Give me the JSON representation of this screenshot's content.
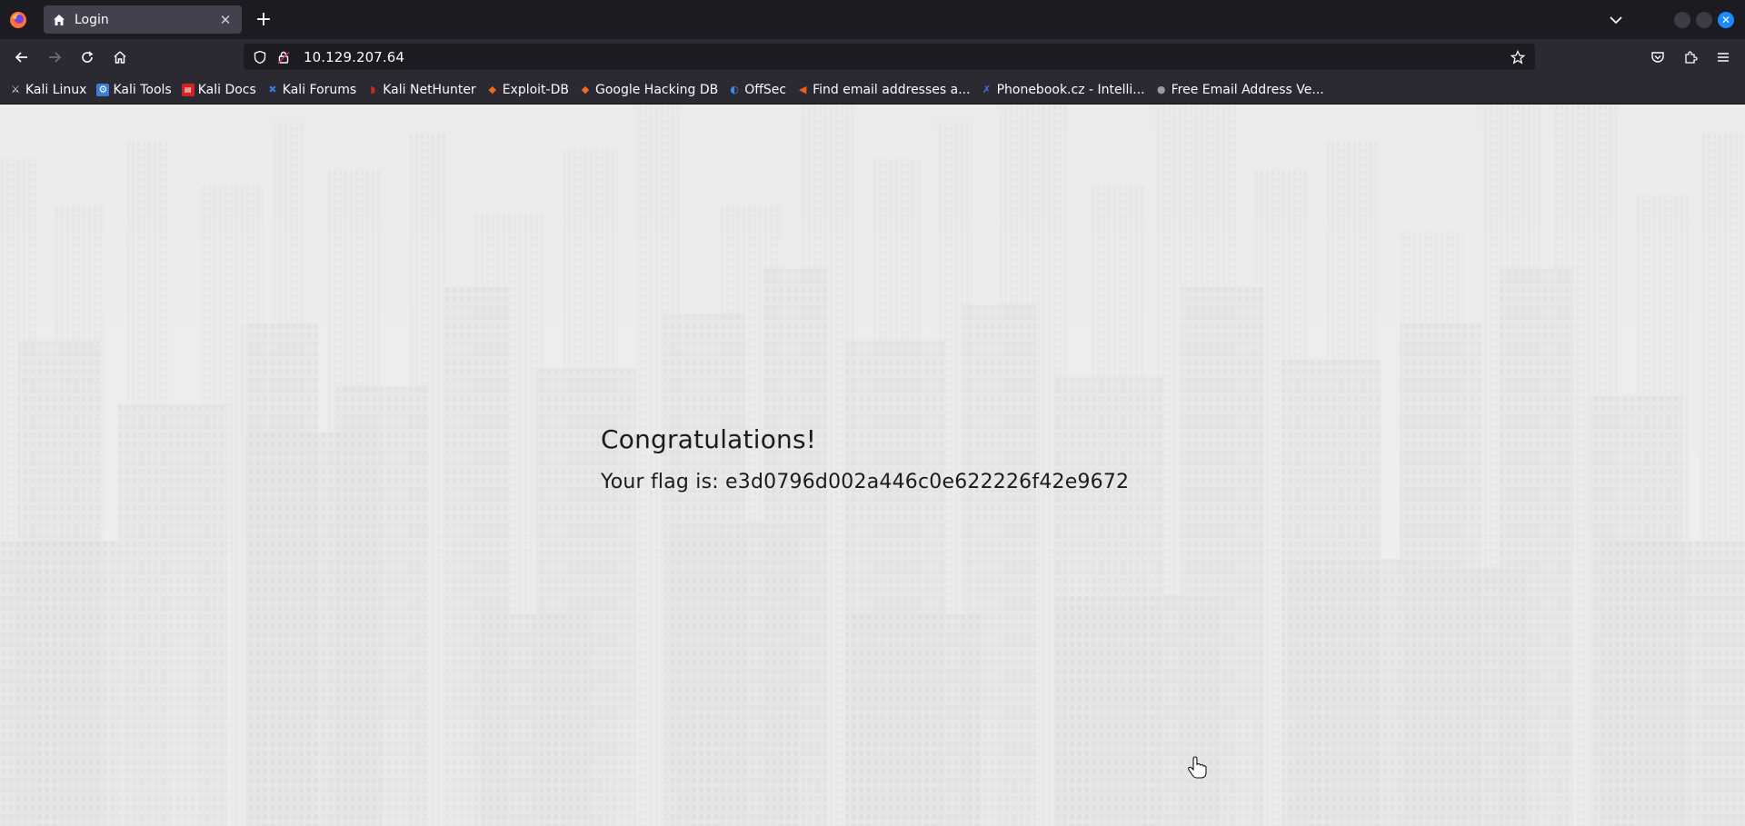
{
  "browser": {
    "tab": {
      "title": "Login"
    },
    "url": "10.129.207.64",
    "bookmarks": [
      {
        "label": "Kali Linux",
        "icon": "kali-dragon-icon",
        "color": "#e6e6e6"
      },
      {
        "label": "Kali Tools",
        "icon": "kali-tools-icon",
        "color": "#3e7bd8"
      },
      {
        "label": "Kali Docs",
        "icon": "kali-docs-icon",
        "color": "#d12424"
      },
      {
        "label": "Kali Forums",
        "icon": "kali-forums-icon",
        "color": "#3a78d8"
      },
      {
        "label": "Kali NetHunter",
        "icon": "nethunter-icon",
        "color": "#d12424"
      },
      {
        "label": "Exploit-DB",
        "icon": "exploit-db-icon",
        "color": "#f06a1f"
      },
      {
        "label": "Google Hacking DB",
        "icon": "ghdb-icon",
        "color": "#f06a1f"
      },
      {
        "label": "OffSec",
        "icon": "offsec-icon",
        "color": "#3c8ad8"
      },
      {
        "label": "Find email addresses a...",
        "icon": "hunter-icon",
        "color": "#f25b24"
      },
      {
        "label": "Phonebook.cz - Intelli...",
        "icon": "phonebook-icon",
        "color": "#3a78d8"
      },
      {
        "label": "Free Email Address Ve...",
        "icon": "email-verifier-icon",
        "color": "#9a9a9a"
      }
    ]
  },
  "page": {
    "heading": "Congratulations!",
    "flag_label": "Your flag is:",
    "flag_value": "e3d0796d002a446c0e622226f42e9672"
  }
}
